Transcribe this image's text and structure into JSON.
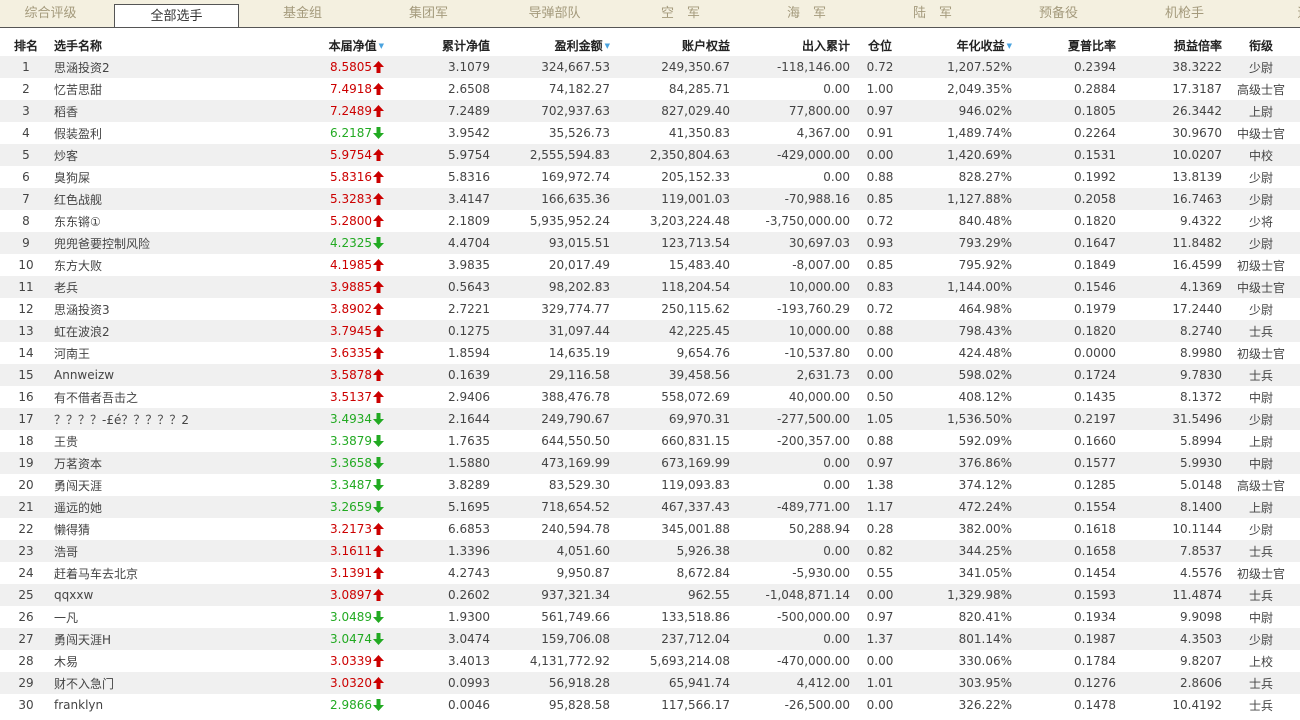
{
  "tabs": [
    {
      "label": "综合评级",
      "active": false
    },
    {
      "label": "全部选手",
      "active": true
    },
    {
      "label": "基金组",
      "active": false
    },
    {
      "label": "集团军",
      "active": false
    },
    {
      "label": "导弹部队",
      "active": false
    },
    {
      "label": "空　军",
      "active": false
    },
    {
      "label": "海　军",
      "active": false
    },
    {
      "label": "陆　军",
      "active": false
    },
    {
      "label": "预备役",
      "active": false
    },
    {
      "label": "机枪手",
      "active": false
    },
    {
      "label": "远侦",
      "active": false
    }
  ],
  "columns": [
    {
      "key": "rank",
      "label": "排名",
      "sortable": false
    },
    {
      "key": "name",
      "label": "选手名称",
      "sortable": false
    },
    {
      "key": "nav",
      "label": "本届净值",
      "sortable": true
    },
    {
      "key": "cum_nav",
      "label": "累计净值",
      "sortable": false
    },
    {
      "key": "profit",
      "label": "盈利金额",
      "sortable": true
    },
    {
      "key": "equity",
      "label": "账户权益",
      "sortable": false
    },
    {
      "key": "flow",
      "label": "出入累计",
      "sortable": false
    },
    {
      "key": "position",
      "label": "仓位",
      "sortable": false
    },
    {
      "key": "annual",
      "label": "年化收益",
      "sortable": true
    },
    {
      "key": "sharpe",
      "label": "夏普比率",
      "sortable": false
    },
    {
      "key": "pl_ratio",
      "label": "损益倍率",
      "sortable": false
    },
    {
      "key": "rank_title",
      "label": "衔级",
      "sortable": false
    }
  ],
  "colors": {
    "up": "#cc0000",
    "down": "#22aa22",
    "sort": "#4aa3df",
    "tab_bg": "#f4f0e0",
    "stripe": "#f0f0f0"
  },
  "rows": [
    {
      "rank": "1",
      "name": "思涵投资2",
      "nav": "8.5805",
      "trend": "up",
      "cum_nav": "3.1079",
      "profit": "324,667.53",
      "equity": "249,350.67",
      "flow": "-118,146.00",
      "position": "0.72",
      "annual": "1,207.52%",
      "sharpe": "0.2394",
      "pl_ratio": "38.3222",
      "rank_title": "少尉"
    },
    {
      "rank": "2",
      "name": "忆苦思甜",
      "nav": "7.4918",
      "trend": "up",
      "cum_nav": "2.6508",
      "profit": "74,182.27",
      "equity": "84,285.71",
      "flow": "0.00",
      "position": "1.00",
      "annual": "2,049.35%",
      "sharpe": "0.2884",
      "pl_ratio": "17.3187",
      "rank_title": "高级士官"
    },
    {
      "rank": "3",
      "name": "稻香",
      "nav": "7.2489",
      "trend": "up",
      "cum_nav": "7.2489",
      "profit": "702,937.63",
      "equity": "827,029.40",
      "flow": "77,800.00",
      "position": "0.97",
      "annual": "946.02%",
      "sharpe": "0.1805",
      "pl_ratio": "26.3442",
      "rank_title": "上尉"
    },
    {
      "rank": "4",
      "name": "假装盈利",
      "nav": "6.2187",
      "trend": "down",
      "cum_nav": "3.9542",
      "profit": "35,526.73",
      "equity": "41,350.83",
      "flow": "4,367.00",
      "position": "0.91",
      "annual": "1,489.74%",
      "sharpe": "0.2264",
      "pl_ratio": "30.9670",
      "rank_title": "中级士官"
    },
    {
      "rank": "5",
      "name": "炒客",
      "nav": "5.9754",
      "trend": "up",
      "cum_nav": "5.9754",
      "profit": "2,555,594.83",
      "equity": "2,350,804.63",
      "flow": "-429,000.00",
      "position": "0.00",
      "annual": "1,420.69%",
      "sharpe": "0.1531",
      "pl_ratio": "10.0207",
      "rank_title": "中校"
    },
    {
      "rank": "6",
      "name": "臭狗屎",
      "nav": "5.8316",
      "trend": "up",
      "cum_nav": "5.8316",
      "profit": "169,972.74",
      "equity": "205,152.33",
      "flow": "0.00",
      "position": "0.88",
      "annual": "828.27%",
      "sharpe": "0.1992",
      "pl_ratio": "13.8139",
      "rank_title": "少尉"
    },
    {
      "rank": "7",
      "name": "红色战舰",
      "nav": "5.3283",
      "trend": "up",
      "cum_nav": "3.4147",
      "profit": "166,635.36",
      "equity": "119,001.03",
      "flow": "-70,988.16",
      "position": "0.85",
      "annual": "1,127.88%",
      "sharpe": "0.2058",
      "pl_ratio": "16.7463",
      "rank_title": "少尉"
    },
    {
      "rank": "8",
      "name": "东东锵①",
      "nav": "5.2800",
      "trend": "up",
      "cum_nav": "2.1809",
      "profit": "5,935,952.24",
      "equity": "3,203,224.48",
      "flow": "-3,750,000.00",
      "position": "0.72",
      "annual": "840.48%",
      "sharpe": "0.1820",
      "pl_ratio": "9.4322",
      "rank_title": "少将"
    },
    {
      "rank": "9",
      "name": "兜兜爸要控制风险",
      "nav": "4.2325",
      "trend": "down",
      "cum_nav": "4.4704",
      "profit": "93,015.51",
      "equity": "123,713.54",
      "flow": "30,697.03",
      "position": "0.93",
      "annual": "793.29%",
      "sharpe": "0.1647",
      "pl_ratio": "11.8482",
      "rank_title": "少尉"
    },
    {
      "rank": "10",
      "name": "东方大败",
      "nav": "4.1985",
      "trend": "up",
      "cum_nav": "3.9835",
      "profit": "20,017.49",
      "equity": "15,483.40",
      "flow": "-8,007.00",
      "position": "0.85",
      "annual": "795.92%",
      "sharpe": "0.1849",
      "pl_ratio": "16.4599",
      "rank_title": "初级士官"
    },
    {
      "rank": "11",
      "name": "老兵",
      "nav": "3.9885",
      "trend": "up",
      "cum_nav": "0.5643",
      "profit": "98,202.83",
      "equity": "118,204.54",
      "flow": "10,000.00",
      "position": "0.83",
      "annual": "1,144.00%",
      "sharpe": "0.1546",
      "pl_ratio": "4.1369",
      "rank_title": "中级士官"
    },
    {
      "rank": "12",
      "name": "思涵投资3",
      "nav": "3.8902",
      "trend": "up",
      "cum_nav": "2.7221",
      "profit": "329,774.77",
      "equity": "250,115.62",
      "flow": "-193,760.29",
      "position": "0.72",
      "annual": "464.98%",
      "sharpe": "0.1979",
      "pl_ratio": "17.2440",
      "rank_title": "少尉"
    },
    {
      "rank": "13",
      "name": "虹在波浪2",
      "nav": "3.7945",
      "trend": "up",
      "cum_nav": "0.1275",
      "profit": "31,097.44",
      "equity": "42,225.45",
      "flow": "10,000.00",
      "position": "0.88",
      "annual": "798.43%",
      "sharpe": "0.1820",
      "pl_ratio": "8.2740",
      "rank_title": "士兵"
    },
    {
      "rank": "14",
      "name": "河南王",
      "nav": "3.6335",
      "trend": "up",
      "cum_nav": "1.8594",
      "profit": "14,635.19",
      "equity": "9,654.76",
      "flow": "-10,537.80",
      "position": "0.00",
      "annual": "424.48%",
      "sharpe": "0.0000",
      "pl_ratio": "8.9980",
      "rank_title": "初级士官"
    },
    {
      "rank": "15",
      "name": "Annweizw",
      "nav": "3.5878",
      "trend": "up",
      "cum_nav": "0.1639",
      "profit": "29,116.58",
      "equity": "39,458.56",
      "flow": "2,631.73",
      "position": "0.00",
      "annual": "598.02%",
      "sharpe": "0.1724",
      "pl_ratio": "9.7830",
      "rank_title": "士兵"
    },
    {
      "rank": "16",
      "name": "有不借者吾击之",
      "nav": "3.5137",
      "trend": "up",
      "cum_nav": "2.9406",
      "profit": "388,476.78",
      "equity": "558,072.69",
      "flow": "40,000.00",
      "position": "0.50",
      "annual": "408.12%",
      "sharpe": "0.1435",
      "pl_ratio": "8.1372",
      "rank_title": "中尉"
    },
    {
      "rank": "17",
      "name": "？？？？-£é？？？？？2",
      "nav": "3.4934",
      "trend": "down",
      "cum_nav": "2.1644",
      "profit": "249,790.67",
      "equity": "69,970.31",
      "flow": "-277,500.00",
      "position": "1.05",
      "annual": "1,536.50%",
      "sharpe": "0.2197",
      "pl_ratio": "31.5496",
      "rank_title": "少尉"
    },
    {
      "rank": "18",
      "name": "王贵",
      "nav": "3.3879",
      "trend": "down",
      "cum_nav": "1.7635",
      "profit": "644,550.50",
      "equity": "660,831.15",
      "flow": "-200,357.00",
      "position": "0.88",
      "annual": "592.09%",
      "sharpe": "0.1660",
      "pl_ratio": "5.8994",
      "rank_title": "上尉"
    },
    {
      "rank": "19",
      "name": "万茗资本",
      "nav": "3.3658",
      "trend": "down",
      "cum_nav": "1.5880",
      "profit": "473,169.99",
      "equity": "673,169.99",
      "flow": "0.00",
      "position": "0.97",
      "annual": "376.86%",
      "sharpe": "0.1577",
      "pl_ratio": "5.9930",
      "rank_title": "中尉"
    },
    {
      "rank": "20",
      "name": "勇闯天涯",
      "nav": "3.3487",
      "trend": "down",
      "cum_nav": "3.8289",
      "profit": "83,529.30",
      "equity": "119,093.83",
      "flow": "0.00",
      "position": "1.38",
      "annual": "374.12%",
      "sharpe": "0.1285",
      "pl_ratio": "5.0148",
      "rank_title": "高级士官"
    },
    {
      "rank": "21",
      "name": "遥远的她",
      "nav": "3.2659",
      "trend": "down",
      "cum_nav": "5.1695",
      "profit": "718,654.52",
      "equity": "467,337.43",
      "flow": "-489,771.00",
      "position": "1.17",
      "annual": "472.24%",
      "sharpe": "0.1554",
      "pl_ratio": "8.1400",
      "rank_title": "上尉"
    },
    {
      "rank": "22",
      "name": "懒得猜",
      "nav": "3.2173",
      "trend": "up",
      "cum_nav": "6.6853",
      "profit": "240,594.78",
      "equity": "345,001.88",
      "flow": "50,288.94",
      "position": "0.28",
      "annual": "382.00%",
      "sharpe": "0.1618",
      "pl_ratio": "10.1144",
      "rank_title": "少尉"
    },
    {
      "rank": "23",
      "name": "浩哥",
      "nav": "3.1611",
      "trend": "up",
      "cum_nav": "1.3396",
      "profit": "4,051.60",
      "equity": "5,926.38",
      "flow": "0.00",
      "position": "0.82",
      "annual": "344.25%",
      "sharpe": "0.1658",
      "pl_ratio": "7.8537",
      "rank_title": "士兵"
    },
    {
      "rank": "24",
      "name": "赶着马车去北京",
      "nav": "3.1391",
      "trend": "up",
      "cum_nav": "4.2743",
      "profit": "9,950.87",
      "equity": "8,672.84",
      "flow": "-5,930.00",
      "position": "0.55",
      "annual": "341.05%",
      "sharpe": "0.1454",
      "pl_ratio": "4.5576",
      "rank_title": "初级士官"
    },
    {
      "rank": "25",
      "name": "qqxxw",
      "nav": "3.0897",
      "trend": "up",
      "cum_nav": "0.2602",
      "profit": "937,321.34",
      "equity": "962.55",
      "flow": "-1,048,871.14",
      "position": "0.00",
      "annual": "1,329.98%",
      "sharpe": "0.1593",
      "pl_ratio": "11.4874",
      "rank_title": "士兵"
    },
    {
      "rank": "26",
      "name": "一凡",
      "nav": "3.0489",
      "trend": "down",
      "cum_nav": "1.9300",
      "profit": "561,749.66",
      "equity": "133,518.86",
      "flow": "-500,000.00",
      "position": "0.97",
      "annual": "820.41%",
      "sharpe": "0.1934",
      "pl_ratio": "9.9098",
      "rank_title": "中尉"
    },
    {
      "rank": "27",
      "name": "勇闯天涯H",
      "nav": "3.0474",
      "trend": "down",
      "cum_nav": "3.0474",
      "profit": "159,706.08",
      "equity": "237,712.04",
      "flow": "0.00",
      "position": "1.37",
      "annual": "801.14%",
      "sharpe": "0.1987",
      "pl_ratio": "4.3503",
      "rank_title": "少尉"
    },
    {
      "rank": "28",
      "name": "木易",
      "nav": "3.0339",
      "trend": "up",
      "cum_nav": "3.4013",
      "profit": "4,131,772.92",
      "equity": "5,693,214.08",
      "flow": "-470,000.00",
      "position": "0.00",
      "annual": "330.06%",
      "sharpe": "0.1784",
      "pl_ratio": "9.8207",
      "rank_title": "上校"
    },
    {
      "rank": "29",
      "name": "财不入急门",
      "nav": "3.0320",
      "trend": "up",
      "cum_nav": "0.0993",
      "profit": "56,918.28",
      "equity": "65,941.74",
      "flow": "4,412.00",
      "position": "1.01",
      "annual": "303.95%",
      "sharpe": "0.1276",
      "pl_ratio": "2.8606",
      "rank_title": "士兵"
    },
    {
      "rank": "30",
      "name": "franklyn",
      "nav": "2.9866",
      "trend": "down",
      "cum_nav": "0.0046",
      "profit": "95,828.58",
      "equity": "117,566.17",
      "flow": "-26,500.00",
      "position": "0.00",
      "annual": "326.22%",
      "sharpe": "0.1478",
      "pl_ratio": "10.4192",
      "rank_title": "士兵"
    }
  ]
}
